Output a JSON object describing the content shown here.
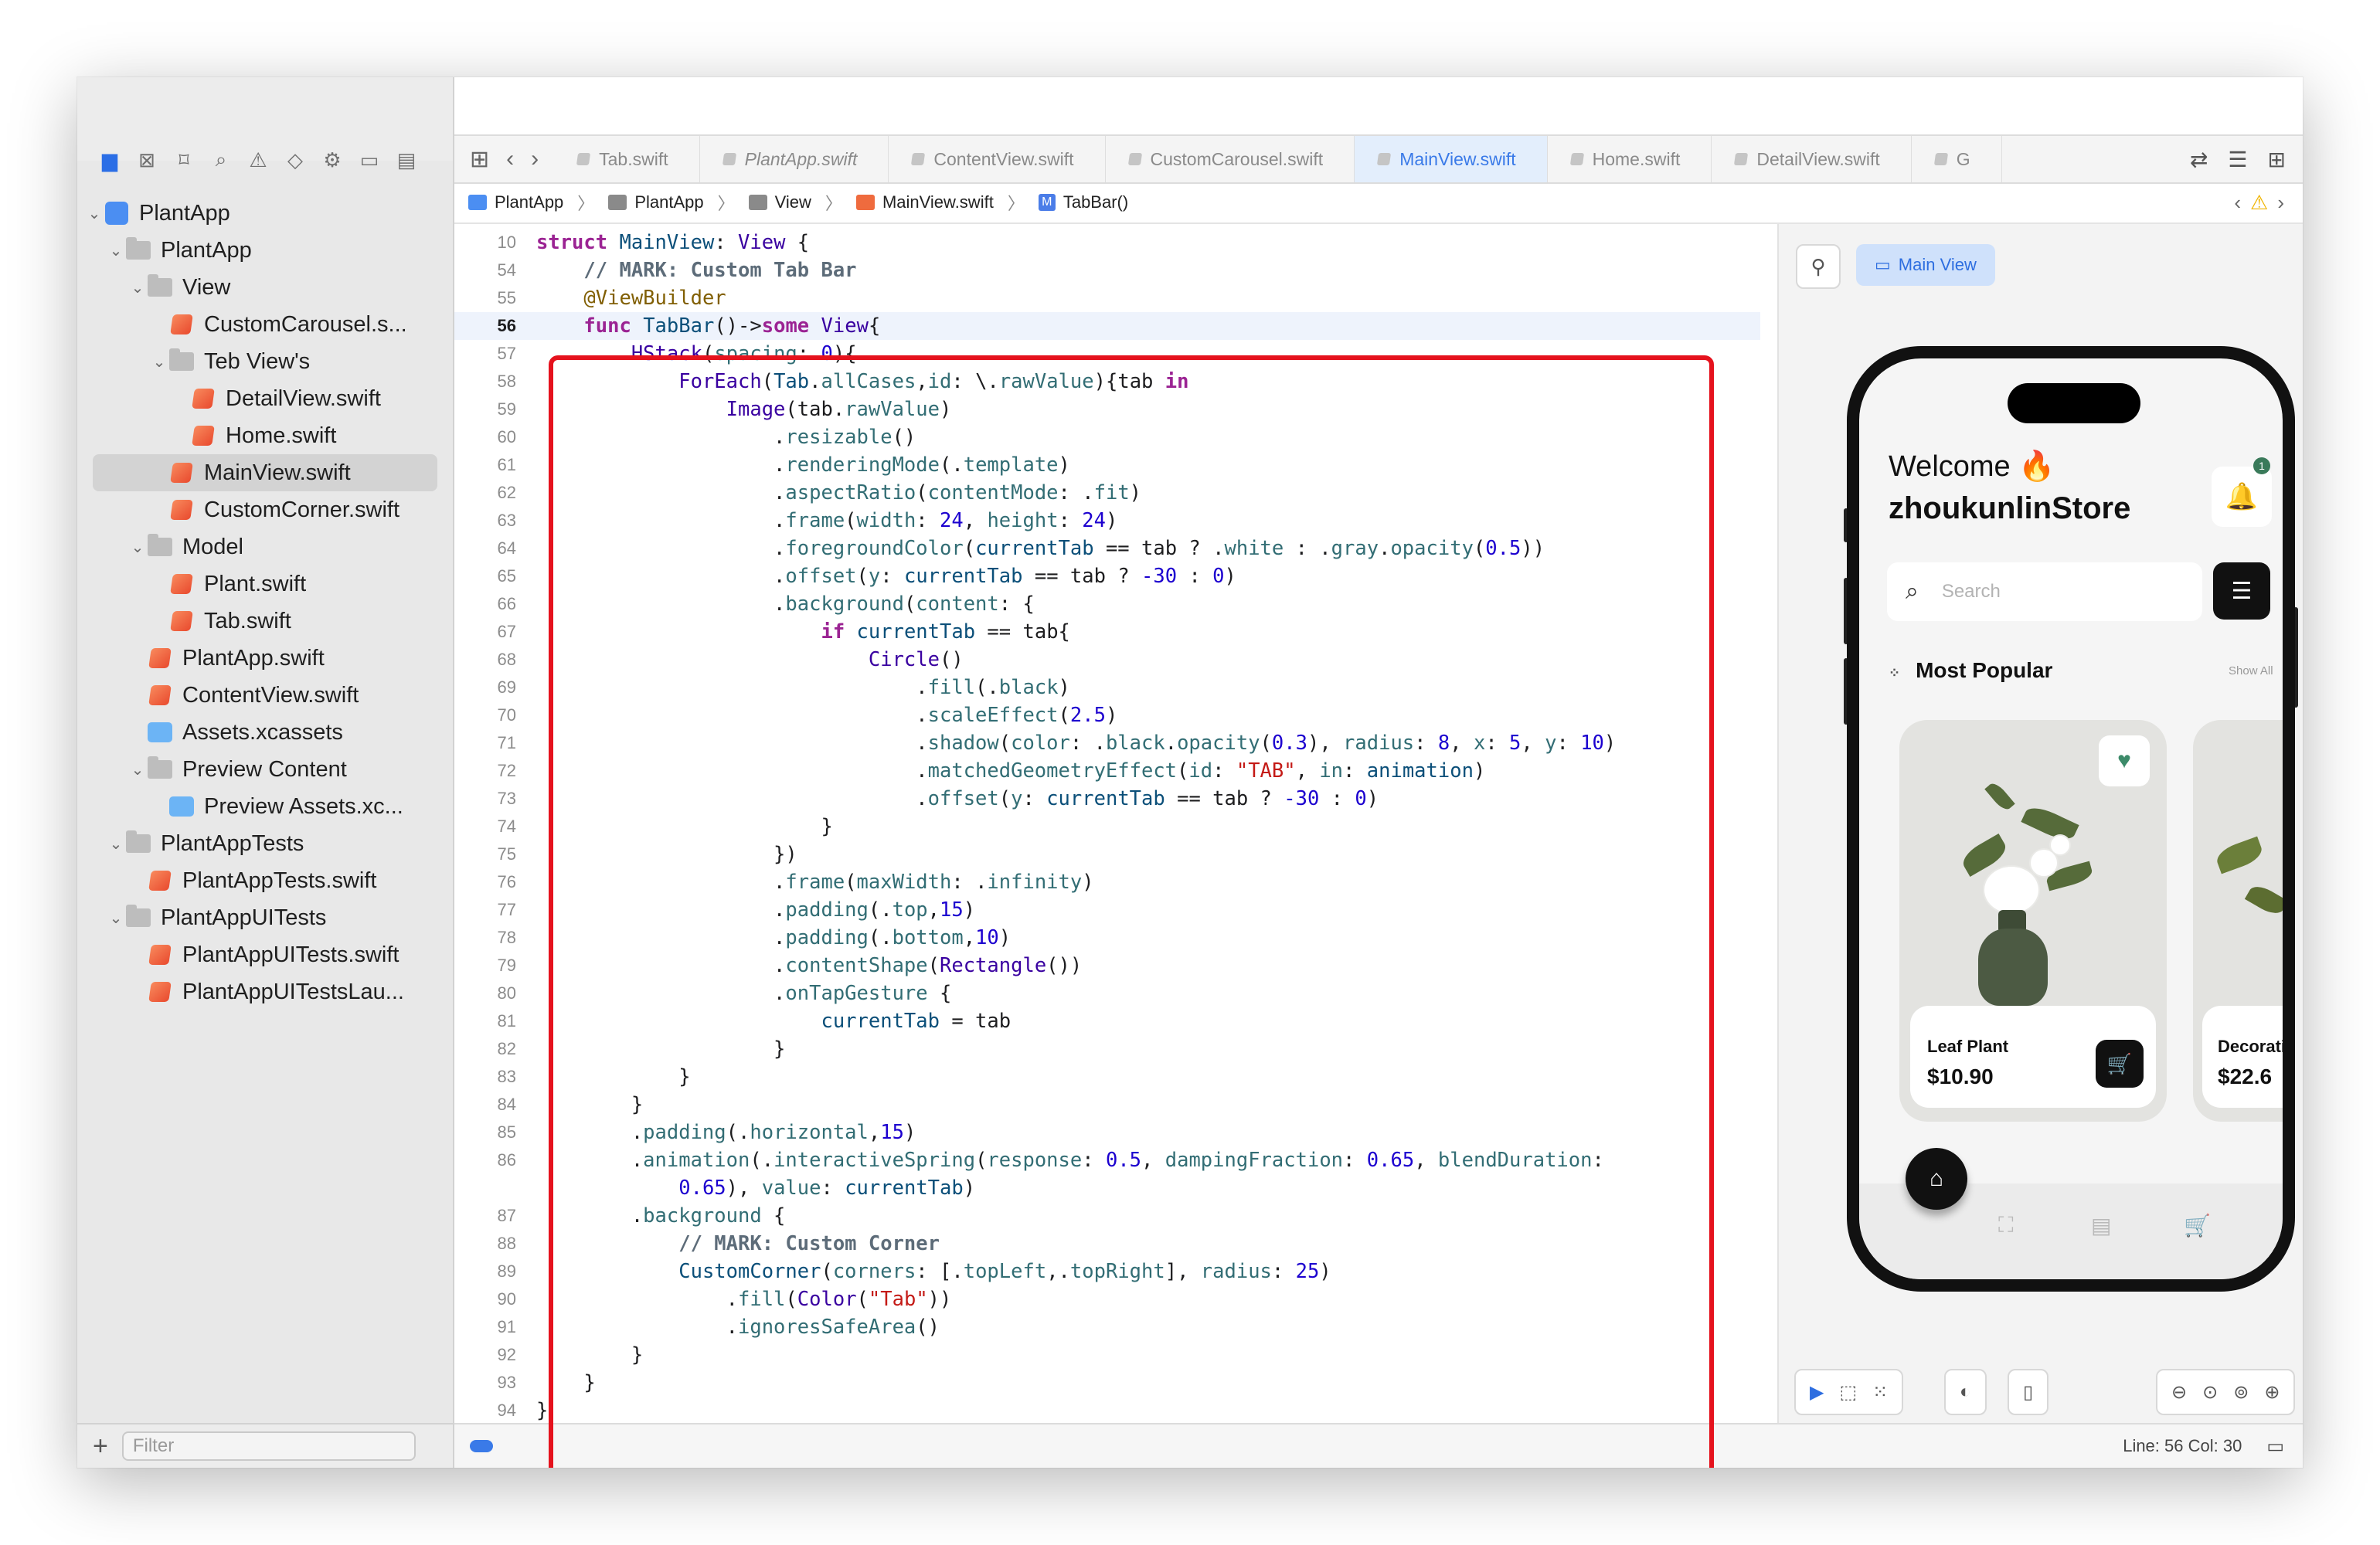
{
  "sidebar": {
    "items": [
      {
        "label": "PlantApp",
        "type": "proj",
        "indent": 0,
        "disclosure": "open"
      },
      {
        "label": "PlantApp",
        "type": "folder",
        "indent": 1,
        "disclosure": "open"
      },
      {
        "label": "View",
        "type": "folder",
        "indent": 2,
        "disclosure": "open"
      },
      {
        "label": "CustomCarousel.s...",
        "type": "swift",
        "indent": 3,
        "disclosure": ""
      },
      {
        "label": "Teb View's",
        "type": "folder",
        "indent": 3,
        "disclosure": "open"
      },
      {
        "label": "DetailView.swift",
        "type": "swift",
        "indent": 4,
        "disclosure": ""
      },
      {
        "label": "Home.swift",
        "type": "swift",
        "indent": 4,
        "disclosure": ""
      },
      {
        "label": "MainView.swift",
        "type": "swift",
        "indent": 3,
        "disclosure": "",
        "selected": true
      },
      {
        "label": "CustomCorner.swift",
        "type": "swift",
        "indent": 3,
        "disclosure": ""
      },
      {
        "label": "Model",
        "type": "folder",
        "indent": 2,
        "disclosure": "open"
      },
      {
        "label": "Plant.swift",
        "type": "swift",
        "indent": 3,
        "disclosure": ""
      },
      {
        "label": "Tab.swift",
        "type": "swift",
        "indent": 3,
        "disclosure": ""
      },
      {
        "label": "PlantApp.swift",
        "type": "swift",
        "indent": 2,
        "disclosure": ""
      },
      {
        "label": "ContentView.swift",
        "type": "swift",
        "indent": 2,
        "disclosure": ""
      },
      {
        "label": "Assets.xcassets",
        "type": "asset",
        "indent": 2,
        "disclosure": ""
      },
      {
        "label": "Preview Content",
        "type": "folder",
        "indent": 2,
        "disclosure": "open"
      },
      {
        "label": "Preview Assets.xc...",
        "type": "asset",
        "indent": 3,
        "disclosure": ""
      },
      {
        "label": "PlantAppTests",
        "type": "folder",
        "indent": 1,
        "disclosure": "open"
      },
      {
        "label": "PlantAppTests.swift",
        "type": "swift",
        "indent": 2,
        "disclosure": ""
      },
      {
        "label": "PlantAppUITests",
        "type": "folder",
        "indent": 1,
        "disclosure": "open"
      },
      {
        "label": "PlantAppUITests.swift",
        "type": "swift",
        "indent": 2,
        "disclosure": ""
      },
      {
        "label": "PlantAppUITestsLau...",
        "type": "swift",
        "indent": 2,
        "disclosure": ""
      }
    ],
    "filter_placeholder": "Filter"
  },
  "tabs": [
    {
      "label": "Tab.swift",
      "active": false,
      "italic": false
    },
    {
      "label": "PlantApp.swift",
      "active": false,
      "italic": true
    },
    {
      "label": "ContentView.swift",
      "active": false,
      "italic": false
    },
    {
      "label": "CustomCarousel.swift",
      "active": false,
      "italic": false
    },
    {
      "label": "MainView.swift",
      "active": true,
      "italic": false
    },
    {
      "label": "Home.swift",
      "active": false,
      "italic": false
    },
    {
      "label": "DetailView.swift",
      "active": false,
      "italic": false
    },
    {
      "label": "G",
      "active": false,
      "italic": false
    }
  ],
  "jumpbar": {
    "items": [
      "PlantApp",
      "PlantApp",
      "View",
      "MainView.swift",
      "TabBar()"
    ]
  },
  "code": {
    "current_line": 56,
    "lines": [
      {
        "n": "10",
        "html": "<span class='k'>struct</span> <span class='t'>MainView</span>: <span class='p'>View</span> {"
      },
      {
        "n": "54",
        "html": "    <span class='c'>// MARK: Custom Tab Bar</span>"
      },
      {
        "n": "55",
        "html": "    <span class='a'>@ViewBuilder</span>"
      },
      {
        "n": "56",
        "html": "    <span class='k'>func</span> <span class='t'>TabBar</span>()-&gt;<span class='k'>some</span> <span class='p'>View</span>{"
      },
      {
        "n": "57",
        "html": "        <span class='p'>HStack</span>(<span class='f'>spacing</span>: <span class='n'>0</span>){"
      },
      {
        "n": "58",
        "html": "            <span class='p'>ForEach</span>(<span class='t'>Tab</span>.<span class='f'>allCases</span>,<span class='f'>id</span>: \\.<span class='f'>rawValue</span>){tab <span class='k'>in</span>"
      },
      {
        "n": "59",
        "html": "                <span class='p'>Image</span>(tab.<span class='f'>rawValue</span>)"
      },
      {
        "n": "60",
        "html": "                    .<span class='f'>resizable</span>()"
      },
      {
        "n": "61",
        "html": "                    .<span class='f'>renderingMode</span>(.<span class='f'>template</span>)"
      },
      {
        "n": "62",
        "html": "                    .<span class='f'>aspectRatio</span>(<span class='f'>contentMode</span>: .<span class='f'>fit</span>)"
      },
      {
        "n": "63",
        "html": "                    .<span class='f'>frame</span>(<span class='f'>width</span>: <span class='n'>24</span>, <span class='f'>height</span>: <span class='n'>24</span>)"
      },
      {
        "n": "64",
        "html": "                    .<span class='f'>foregroundColor</span>(<span class='t'>currentTab</span> == tab ? .<span class='f'>white</span> : .<span class='f'>gray</span>.<span class='f'>opacity</span>(<span class='n'>0.5</span>))"
      },
      {
        "n": "65",
        "html": "                    .<span class='f'>offset</span>(<span class='f'>y</span>: <span class='t'>currentTab</span> == tab ? <span class='n'>-30</span> : <span class='n'>0</span>)"
      },
      {
        "n": "66",
        "html": "                    .<span class='f'>background</span>(<span class='f'>content</span>: {"
      },
      {
        "n": "67",
        "html": "                        <span class='k'>if</span> <span class='t'>currentTab</span> == tab{"
      },
      {
        "n": "68",
        "html": "                            <span class='p'>Circle</span>()"
      },
      {
        "n": "69",
        "html": "                                .<span class='f'>fill</span>(.<span class='f'>black</span>)"
      },
      {
        "n": "70",
        "html": "                                .<span class='f'>scaleEffect</span>(<span class='n'>2.5</span>)"
      },
      {
        "n": "71",
        "html": "                                .<span class='f'>shadow</span>(<span class='f'>color</span>: .<span class='f'>black</span>.<span class='f'>opacity</span>(<span class='n'>0.3</span>), <span class='f'>radius</span>: <span class='n'>8</span>, <span class='f'>x</span>: <span class='n'>5</span>, <span class='f'>y</span>: <span class='n'>10</span>)"
      },
      {
        "n": "72",
        "html": "                                .<span class='f'>matchedGeometryEffect</span>(<span class='f'>id</span>: <span class='s'>\"TAB\"</span>, <span class='f'>in</span>: <span class='t'>animation</span>)"
      },
      {
        "n": "73",
        "html": "                                .<span class='f'>offset</span>(<span class='f'>y</span>: <span class='t'>currentTab</span> == tab ? <span class='n'>-30</span> : <span class='n'>0</span>)"
      },
      {
        "n": "74",
        "html": "                        }"
      },
      {
        "n": "75",
        "html": "                    })"
      },
      {
        "n": "76",
        "html": "                    .<span class='f'>frame</span>(<span class='f'>maxWidth</span>: .<span class='f'>infinity</span>)"
      },
      {
        "n": "77",
        "html": "                    .<span class='f'>padding</span>(.<span class='f'>top</span>,<span class='n'>15</span>)"
      },
      {
        "n": "78",
        "html": "                    .<span class='f'>padding</span>(.<span class='f'>bottom</span>,<span class='n'>10</span>)"
      },
      {
        "n": "79",
        "html": "                    .<span class='f'>contentShape</span>(<span class='p'>Rectangle</span>())"
      },
      {
        "n": "80",
        "html": "                    .<span class='f'>onTapGesture</span> {"
      },
      {
        "n": "81",
        "html": "                        <span class='t'>currentTab</span> = tab"
      },
      {
        "n": "82",
        "html": "                    }"
      },
      {
        "n": "83",
        "html": "            }"
      },
      {
        "n": "84",
        "html": "        }"
      },
      {
        "n": "85",
        "html": "        .<span class='f'>padding</span>(.<span class='f'>horizontal</span>,<span class='n'>15</span>)"
      },
      {
        "n": "86",
        "html": "        .<span class='f'>animation</span>(.<span class='f'>interactiveSpring</span>(<span class='f'>response</span>: <span class='n'>0.5</span>, <span class='f'>dampingFraction</span>: <span class='n'>0.65</span>, <span class='f'>blendDuration</span>:"
      },
      {
        "n": "",
        "html": "            <span class='n'>0.65</span>), <span class='f'>value</span>: <span class='t'>currentTab</span>)"
      },
      {
        "n": "87",
        "html": "        .<span class='f'>background</span> {"
      },
      {
        "n": "88",
        "html": "            <span class='c'>// MARK: Custom Corner</span>"
      },
      {
        "n": "89",
        "html": "            <span class='t'>CustomCorner</span>(<span class='f'>corners</span>: [.<span class='f'>topLeft</span>,.<span class='f'>topRight</span>], <span class='f'>radius</span>: <span class='n'>25</span>)"
      },
      {
        "n": "90",
        "html": "                .<span class='f'>fill</span>(<span class='p'>Color</span>(<span class='s'>\"Tab\"</span>))"
      },
      {
        "n": "91",
        "html": "                .<span class='f'>ignoresSafeArea</span>()"
      },
      {
        "n": "92",
        "html": "        }"
      },
      {
        "n": "93",
        "html": "    }"
      },
      {
        "n": "94",
        "html": "}"
      }
    ]
  },
  "preview": {
    "main_view_label": "Main View",
    "welcome": "Welcome 🔥",
    "store": "zhoukunlinStore",
    "notification_count": "1",
    "search_placeholder": "Search",
    "section_title": "Most Popular",
    "show_all": "Show All",
    "cards": [
      {
        "name": "Leaf Plant",
        "price": "$10.90"
      },
      {
        "name": "Decorati",
        "price": "$22.6"
      }
    ]
  },
  "status": {
    "position": "Line: 56  Col: 30"
  },
  "colors": {
    "accent": "#3a7ae8",
    "highlight_border": "#e5121d",
    "heart": "#3c8a69"
  }
}
